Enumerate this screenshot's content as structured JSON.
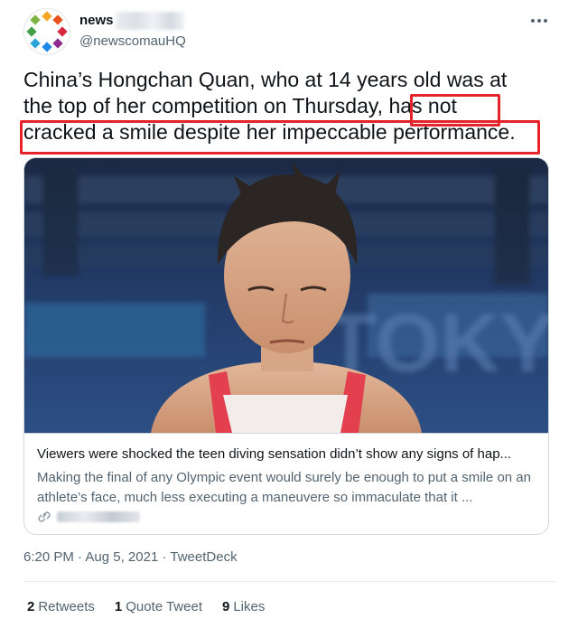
{
  "user": {
    "display_name": "news",
    "handle": "@newscomauHQ",
    "avatar_icon": "news-logo-dots"
  },
  "tweet": {
    "lines": [
      "China’s Hongchan Quan, who at 14 years old was at",
      "the top of her competition on Thursday, has not",
      "cracked a smile despite her impeccable performance."
    ]
  },
  "highlight_color": "#e5232a",
  "card": {
    "image_text": "TOKY",
    "title": "Viewers were shocked the teen diving sensation didn’t show any signs of hap...",
    "description": "Making the final of any Olympic event would surely be enough to put a smile on an athlete’s face, much less executing a maneuvere so immaculate that it ...",
    "link_icon": "link-icon"
  },
  "meta": {
    "time": "6:20 PM",
    "separator": "·",
    "date": "Aug 5, 2021",
    "source": "TweetDeck"
  },
  "stats": {
    "retweets_count": "2",
    "retweets_label": "Retweets",
    "quotes_count": "1",
    "quotes_label": "Quote Tweet",
    "likes_count": "9",
    "likes_label": "Likes"
  },
  "more_icon": "more-icon"
}
